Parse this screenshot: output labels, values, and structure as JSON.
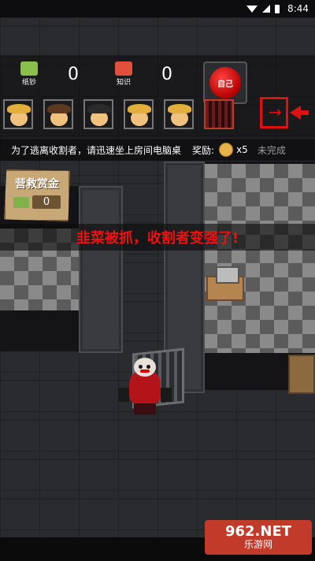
{
  "status_bar": {
    "time": "8:44"
  },
  "resources": [
    {
      "label": "纸钞",
      "count": "0"
    },
    {
      "label": "知识",
      "count": "0"
    }
  ],
  "self_button": {
    "label": "自己"
  },
  "avatars": [
    {
      "type": "straw-hat"
    },
    {
      "type": "brown-hair"
    },
    {
      "type": "dark-hat"
    },
    {
      "type": "straw-hat"
    },
    {
      "type": "straw-hat"
    },
    {
      "type": "locked"
    }
  ],
  "task": {
    "text": "为了逃离收割者，请迅速坐上房间电脑桌",
    "reward_label": "奖励:",
    "reward_count": "x5",
    "status": "未完成"
  },
  "rescue": {
    "title": "营救赏金",
    "value": "0"
  },
  "alert": {
    "text": "韭菜被抓，收割者变强了!"
  },
  "watermark": {
    "main": "962.NET",
    "sub": "乐游网"
  },
  "colors": {
    "alert": "#ee1111",
    "exit": "#dd1111",
    "rescue_card": "#c9a878"
  }
}
